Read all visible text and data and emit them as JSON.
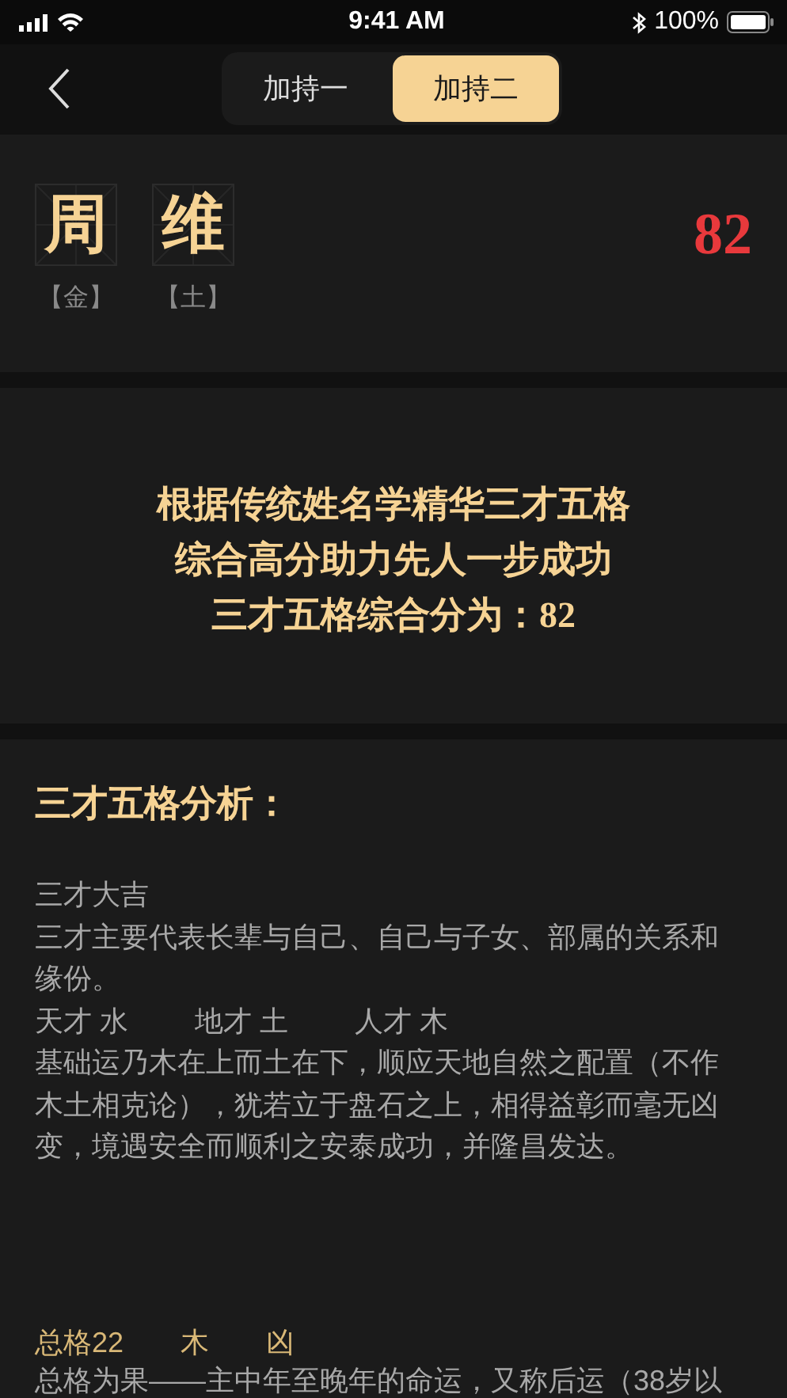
{
  "status_bar": {
    "time": "9:41 AM",
    "battery": "100%"
  },
  "nav": {
    "tabs": [
      {
        "label": "加持一",
        "selected": false
      },
      {
        "label": "加持二",
        "selected": true
      }
    ]
  },
  "name_card": {
    "characters": [
      {
        "char": "周",
        "element": "【金】"
      },
      {
        "char": "维",
        "element": "【土】"
      }
    ],
    "score": "82"
  },
  "slogan": [
    "根据传统姓名学精华三才五格",
    "综合高分助力先人一步成功",
    "三才五格综合分为：82"
  ],
  "analysis": {
    "heading": "三才五格分析：",
    "sancai_title": "三才大吉",
    "sancai_intro": "三才主要代表长辈与自己、自己与子女、部属的关系和缘份。",
    "sancai": [
      "天才 水",
      "地才 土",
      "人才 木"
    ],
    "sancai_text": "基础运乃木在上而土在下，顺应天地自然之配置（不作木土相克论），犹若立于盘石之上，相得益彰而毫无凶变，境遇安全而顺利之安泰成功，并隆昌发达。",
    "total": {
      "label": "总格22",
      "element": "木",
      "verdict": "凶"
    },
    "total_text": "总格为果——主中年至晚年的命运，又称后运（38岁以"
  }
}
